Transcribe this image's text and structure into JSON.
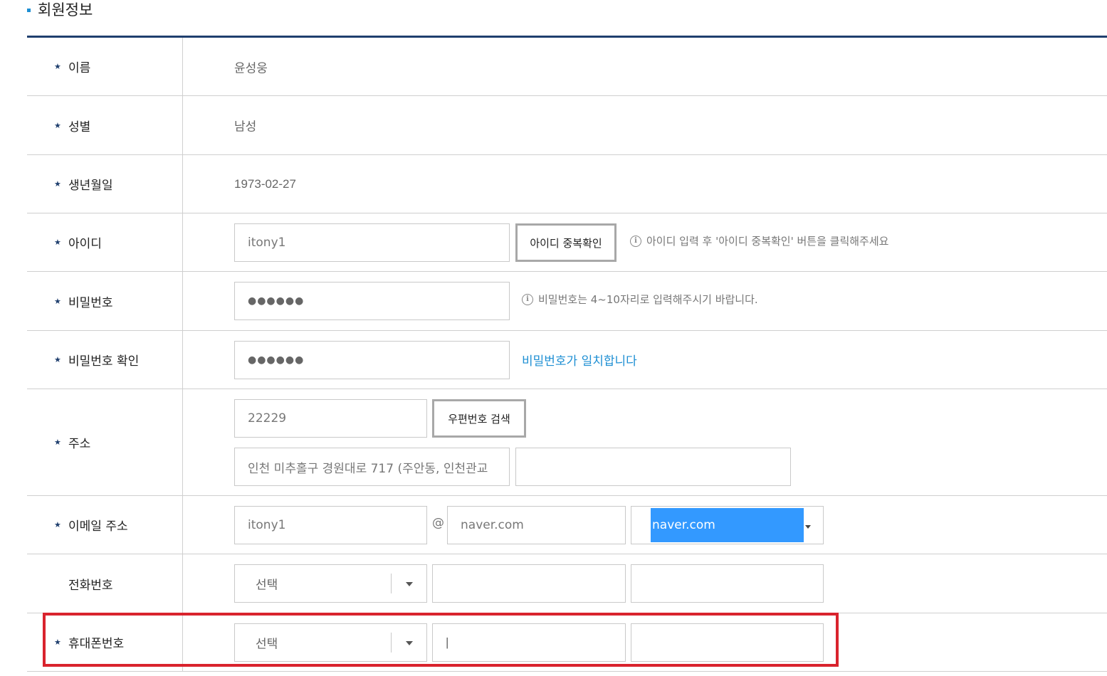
{
  "section": {
    "title": "회원정보"
  },
  "rows": {
    "name": {
      "label": "이름",
      "value": "윤성웅"
    },
    "gender": {
      "label": "성별",
      "value": "남성"
    },
    "birth": {
      "label": "생년월일",
      "value": "1973-02-27"
    },
    "userid": {
      "label": "아이디",
      "value": "itony1",
      "button": "아이디 중복확인",
      "help": "아이디 입력 후 '아이디 중복확인' 버튼을 클릭해주세요"
    },
    "password": {
      "label": "비밀번호",
      "value": "●●●●●●",
      "help": "비밀번호는 4~10자리로 입력해주시기 바랍니다."
    },
    "password_confirm": {
      "label": "비밀번호 확인",
      "value": "●●●●●●",
      "status": "비밀번호가 일치합니다"
    },
    "address": {
      "label": "주소",
      "zipcode": "22229",
      "button": "우편번호 검색",
      "address1": "인천 미추홀구 경원대로 717 (주안동, 인천관교",
      "address2": ""
    },
    "email": {
      "label": "이메일 주소",
      "local": "itony1",
      "at": "@",
      "domain": "naver.com",
      "domain_select": "naver.com"
    },
    "phone": {
      "label": "전화번호",
      "select": "선택",
      "part2": "",
      "part3": ""
    },
    "mobile": {
      "label": "휴대폰번호",
      "select": "선택",
      "part2": "|",
      "part3": ""
    }
  },
  "info_icon": "info-icon",
  "star_symbol": "★",
  "colors": {
    "accent": "#1e8fd3",
    "header_border": "#1f3f6e",
    "highlight": "#d9232d",
    "select_highlight": "#3399ff"
  }
}
